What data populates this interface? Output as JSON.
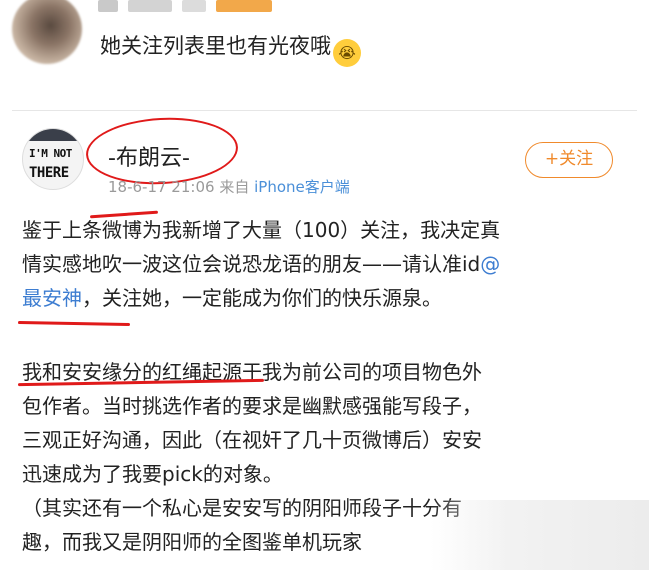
{
  "comment": {
    "text": "她关注列表里也有光夜哦",
    "emoji": "😭"
  },
  "post": {
    "avatar_line1": "I'M NOT",
    "avatar_line2": "THERE",
    "username": "-布朗云-",
    "timestamp": "18-6-17 21:06",
    "source_prefix": "来自",
    "source": "iPhone客户端",
    "follow_label": "+关注",
    "paragraph1": {
      "line1": "鉴于上条微博为我新增了大量（100）关注，我决定真",
      "line2_a": "情实感地吹一波这位会说恐龙语的朋友——请认准id",
      "line2_link": "@",
      "line3_link": "最安神",
      "line3_b": "，关注她，一定能成为你们的快乐源泉。"
    },
    "paragraph2": {
      "line1": "我和安安缘分的红绳起源于我为前公司的项目物色外",
      "line2": "包作者。当时挑选作者的要求是幽默感强能写段子，",
      "line3": "三观正好沟通，因此（在视奸了几十页微博后）安安",
      "line4": "迅速成为了我要pick的对象。",
      "line5": "（其实还有一个私心是安安写的阴阳师段子十分有",
      "line6": "趣，而我又是阴阳师的全图鉴单机玩家"
    }
  },
  "colors": {
    "annotation_red": "#e01a1a",
    "link_blue": "#3d7dd1",
    "follow_orange": "#f08a2c",
    "meta_gray": "#9a9a9a"
  }
}
